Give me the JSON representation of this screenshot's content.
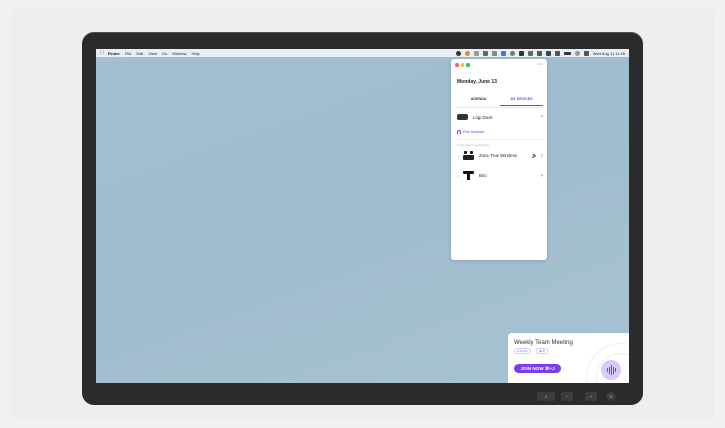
{
  "menubar": {
    "items": [
      "Finder",
      "File",
      "Edit",
      "View",
      "Go",
      "Window",
      "Help"
    ],
    "clock": "Wed Aug 11  11:45"
  },
  "popover": {
    "date": "Monday, June 13",
    "tabs": [
      {
        "label": "AGENDA",
        "active": false
      },
      {
        "label": "MY DEVICES",
        "active": true
      }
    ],
    "dock": {
      "name": "Logi Dock"
    },
    "pair_headset": "Pair headset",
    "section_label": "Connected to Logi Dock",
    "devices": [
      {
        "name": "Zone True Wireless",
        "icon": "earbuds-icon"
      },
      {
        "name": "Brio",
        "icon": "webcam-icon"
      }
    ]
  },
  "meeting": {
    "title": "Weekly Team Meeting",
    "time_chip": "in 5 min",
    "people_chip": "8",
    "join_label": "JOIN NOW ⌘+J"
  },
  "colors": {
    "accent": "#7a3cf0",
    "desktop": "#a3c1d3",
    "bezel": "#2b2b2d"
  }
}
